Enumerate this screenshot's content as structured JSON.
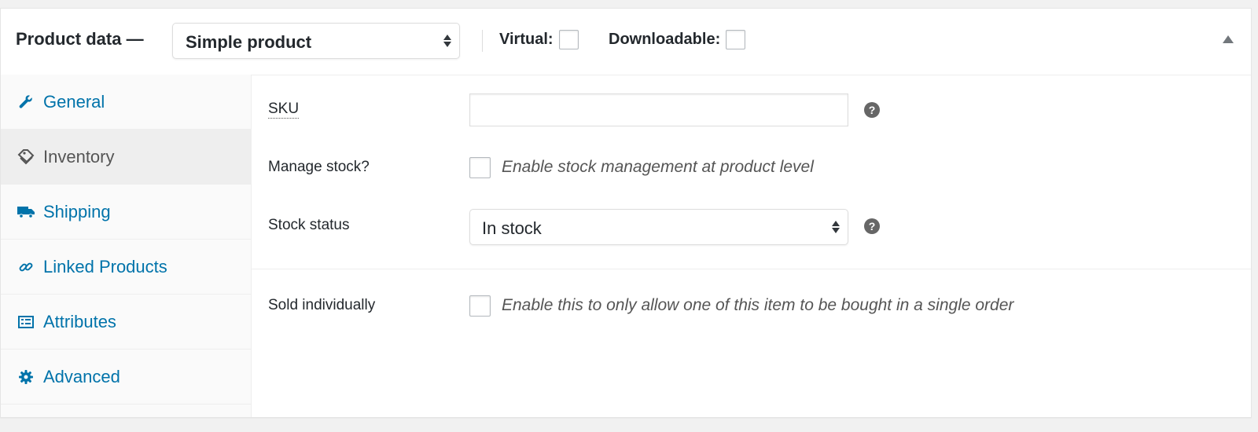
{
  "header": {
    "title": "Product data —",
    "product_type": "Simple product",
    "virtual_label": "Virtual:",
    "downloadable_label": "Downloadable:",
    "virtual_checked": false,
    "downloadable_checked": false
  },
  "tabs": [
    {
      "label": "General",
      "icon": "wrench-icon",
      "active": false
    },
    {
      "label": "Inventory",
      "icon": "tag-icon",
      "active": true
    },
    {
      "label": "Shipping",
      "icon": "truck-icon",
      "active": false
    },
    {
      "label": "Linked Products",
      "icon": "link-icon",
      "active": false
    },
    {
      "label": "Attributes",
      "icon": "list-icon",
      "active": false
    },
    {
      "label": "Advanced",
      "icon": "gear-icon",
      "active": false
    }
  ],
  "fields": {
    "sku": {
      "label": "SKU",
      "value": ""
    },
    "manage_stock": {
      "label": "Manage stock?",
      "description": "Enable stock management at product level",
      "checked": false
    },
    "stock_status": {
      "label": "Stock status",
      "value": "In stock"
    },
    "sold_individually": {
      "label": "Sold individually",
      "description": "Enable this to only allow one of this item to be bought in a single order",
      "checked": false
    },
    "help_glyph": "?"
  },
  "colors": {
    "link": "#0073aa",
    "active_tab_bg": "#eeeeee",
    "text": "#23282d"
  }
}
